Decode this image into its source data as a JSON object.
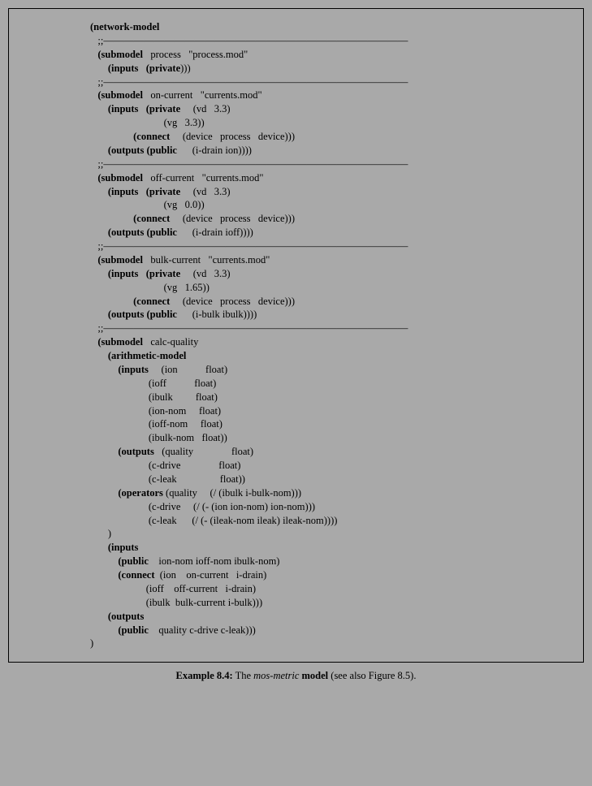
{
  "code": {
    "l01": "(network-model",
    "l02": "   ;;——————————————————————————————",
    "l03a": "   (submodel",
    "l03b": "   process   \"process.mod\"",
    "l04a": "       (inputs   (private",
    "l04b": ")))",
    "l05": "   ;;——————————————————————————————",
    "l06a": "   (submodel",
    "l06b": "   on-current   \"currents.mod\"",
    "l07a": "       (inputs   (private",
    "l07b": "     (vd   3.3)",
    "l08": "                             (vg   3.3))",
    "l09a": "                 (connect",
    "l09b": "     (device   process   device)))",
    "l10a": "       (outputs (public",
    "l10b": "      (i-drain ion))))",
    "l11": "   ;;——————————————————————————————",
    "l12a": "   (submodel",
    "l12b": "   off-current   \"currents.mod\"",
    "l13a": "       (inputs   (private",
    "l13b": "     (vd   3.3)",
    "l14": "                             (vg   0.0))",
    "l15a": "                 (connect",
    "l15b": "     (device   process   device)))",
    "l16a": "       (outputs (public",
    "l16b": "      (i-drain ioff))))",
    "l17": "   ;;——————————————————————————————",
    "l18a": "   (submodel",
    "l18b": "   bulk-current   \"currents.mod\"",
    "l19a": "       (inputs   (private",
    "l19b": "     (vd   3.3)",
    "l20": "                             (vg   1.65))",
    "l21a": "                 (connect",
    "l21b": "     (device   process   device)))",
    "l22a": "       (outputs (public",
    "l22b": "      (i-bulk ibulk))))",
    "l23": "   ;;——————————————————————————————",
    "l24a": "   (submodel",
    "l24b": "   calc-quality",
    "l25": "       (arithmetic-model",
    "l26a": "           (inputs",
    "l26b": "     (ion           float)",
    "l27": "                       (ioff           float)",
    "l28": "                       (ibulk         float)",
    "l29": "                       (ion-nom     float)",
    "l30": "                       (ioff-nom     float)",
    "l31": "                       (ibulk-nom   float))",
    "l32a": "           (outputs",
    "l32b": "   (quality               float)",
    "l33": "                       (c-drive               float)",
    "l34": "                       (c-leak                 float))",
    "l35a": "           (operators",
    "l35b": " (quality     (/ (ibulk i-bulk-nom)))",
    "l36": "                       (c-drive     (/ (- (ion ion-nom) ion-nom)))",
    "l37": "                       (c-leak      (/ (- (ileak-nom ileak) ileak-nom))))",
    "l38": "       )",
    "l39": "       (inputs",
    "l40a": "           (public",
    "l40b": "    ion-nom ioff-nom ibulk-nom)",
    "l41a": "           (connect",
    "l41b": "  (ion    on-current   i-drain)",
    "l42": "                      (ioff    off-current   i-drain)",
    "l43": "                      (ibulk  bulk-current i-bulk)))",
    "l44": "       (outputs",
    "l45a": "           (public",
    "l45b": "    quality c-drive c-leak)))",
    "l46": ")"
  },
  "caption": {
    "label": "Example 8.4:",
    "pre": " The ",
    "em": "mos-metric",
    "mid": " ",
    "bold2": "model",
    "post": " (see also Figure 8.5)."
  }
}
